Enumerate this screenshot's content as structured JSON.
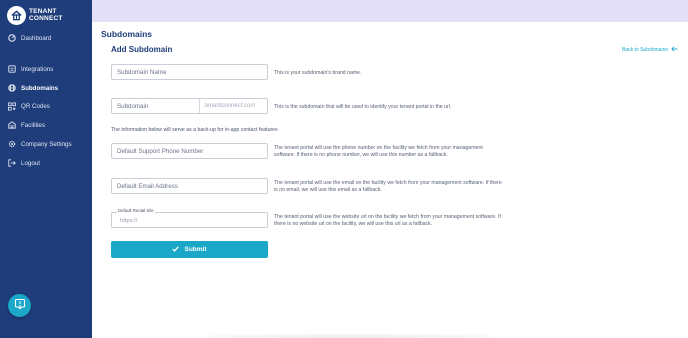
{
  "brand": {
    "logo_line1": "TENANT",
    "logo_line2": "CONNECT"
  },
  "sidebar": {
    "items": [
      {
        "label": "Dashboard",
        "icon": "dashboard-icon"
      },
      {
        "label": "Integrations",
        "icon": "integrations-icon"
      },
      {
        "label": "Subdomains",
        "icon": "subdomains-icon",
        "active": true
      },
      {
        "label": "QR Codes",
        "icon": "qr-code-icon"
      },
      {
        "label": "Facilities",
        "icon": "facilities-icon"
      },
      {
        "label": "Company Settings",
        "icon": "gear-icon"
      },
      {
        "label": "Logout",
        "icon": "logout-icon"
      }
    ]
  },
  "page": {
    "title": "Subdomains",
    "section_title": "Add Subdomain",
    "back_link": "Back to Subdomains"
  },
  "form": {
    "name_placeholder": "Subdomain Name",
    "name_help": "This is your subdomain's brand name.",
    "subdomain_placeholder": "Subdomain",
    "subdomain_suffix": ".tenantconnect.com",
    "subdomain_help": "This is the subdomain that will be used to identify your tenant portal in the url.",
    "backup_note": "The information below will serve as a back-up for in-app contact features",
    "phone_placeholder": "Default Support Phone Number",
    "phone_help": "The tenant portal will use the phone number on the facility we fetch from your management software. If there is no phone number, we will use this number as a fallback.",
    "email_placeholder": "Default Email Address",
    "email_help": "The tenant portal will use the email on the facility we fetch from your management software. If there is no email, we will use this email as a fallback.",
    "rental_label": "Default Rental Site",
    "rental_placeholder": "https://",
    "rental_help": "The tenant portal will use the website url on the facility we fetch from your management software. If there is no website url on the facility, we will use this url as a fallback.",
    "submit_label": "Submit"
  },
  "colors": {
    "sidebar": "#1e3d7a",
    "accent": "#1aa7c8",
    "topbar": "#e3e0f8"
  }
}
